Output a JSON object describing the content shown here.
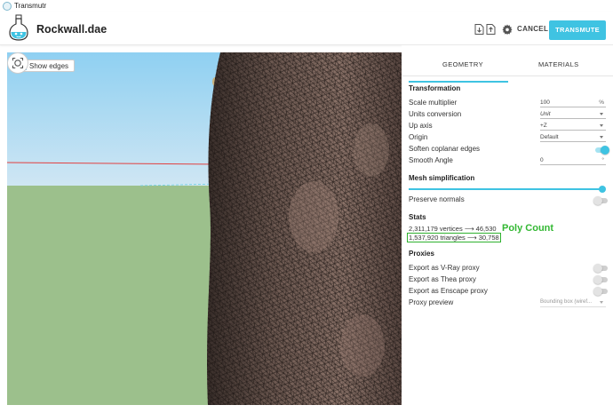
{
  "window": {
    "title": "Transmutr"
  },
  "header": {
    "file_name": "Rockwall.dae",
    "cancel_label": "CANCEL",
    "transmute_label": "TRANSMUTE"
  },
  "viewport": {
    "show_edges_label": "Show edges",
    "show_edges_checked": true
  },
  "tabs": [
    {
      "label": "GEOMETRY",
      "active": true
    },
    {
      "label": "MATERIALS",
      "active": false
    }
  ],
  "transformation": {
    "title": "Transformation",
    "scale_label": "Scale multiplier",
    "scale_value": "100",
    "scale_unit": "%",
    "units_label": "Units conversion",
    "units_value": "Unit",
    "up_axis_label": "Up axis",
    "up_axis_value": "+Z",
    "origin_label": "Origin",
    "origin_value": "Default",
    "soften_label": "Soften coplanar edges",
    "soften_on": true,
    "smooth_label": "Smooth Angle",
    "smooth_value": "0",
    "smooth_unit": "°"
  },
  "mesh": {
    "title": "Mesh simplification",
    "slider_fraction": 1.0,
    "preserve_label": "Preserve normals",
    "preserve_on": false
  },
  "stats": {
    "title": "Stats",
    "vertices": "2,311,179 vertices ⟶ 46,530",
    "triangles": "1,537,920 triangles ⟶ 30,758",
    "annotation": "Poly Count"
  },
  "proxies": {
    "title": "Proxies",
    "vray_label": "Export as V-Ray proxy",
    "thea_label": "Export as Thea proxy",
    "enscape_label": "Export as Enscape proxy",
    "preview_label": "Proxy preview",
    "preview_value": "Bounding box (wiref..."
  },
  "colors": {
    "accent": "#3fc3e2",
    "annotation": "#33b833"
  }
}
